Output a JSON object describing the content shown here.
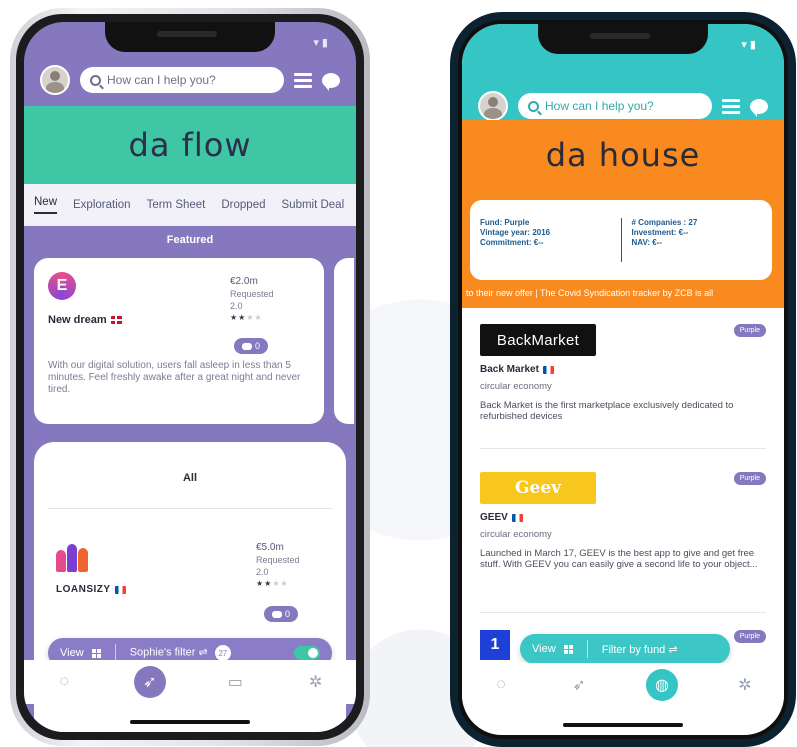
{
  "left_app": {
    "search_placeholder": "How can I help you?",
    "brand": "da flow",
    "tabs": [
      {
        "label": "New",
        "active": true
      },
      {
        "label": "Exploration",
        "active": false
      },
      {
        "label": "Term Sheet",
        "active": false
      },
      {
        "label": "Dropped",
        "active": false
      },
      {
        "label": "Submit Deal",
        "active": false
      }
    ],
    "featured_label": "Featured",
    "featured_card": {
      "logo_letter": "E",
      "name": "New dream",
      "amount": "€2.0m",
      "amount_label": "Requested",
      "version": "2.0",
      "stars_filled": 2,
      "stars_total": 4,
      "message_count": "0",
      "description": "With our digital solution, users fall asleep in less than 5 minutes. Feel freshly awake after a great night and never tired."
    },
    "all_label": "All",
    "list_card": {
      "name": "LOANSIZY",
      "amount": "€5.0m",
      "amount_label": "Requested",
      "version": "2.0",
      "stars_filled": 2,
      "stars_total": 4,
      "message_count": "0"
    },
    "filter_bar": {
      "view_label": "View",
      "filter_label": "Sophie's filter",
      "filter_count": "27",
      "toggle_on": true
    },
    "colors": {
      "accent": "#8678bf",
      "brand_band": "#3fc6a4"
    }
  },
  "right_app": {
    "search_placeholder": "How can I help you?",
    "brand": "da house",
    "fund_card": {
      "fund": "Fund: Purple",
      "vintage": "Vintage year: 2016",
      "commitment": "Commitment: €--",
      "companies": "# Companies : 27",
      "investment": "Investment: €--",
      "nav": "NAV: €--"
    },
    "ticker": "to their new offer  |  The Covid Syndication tracker by ZCB is all",
    "deals": [
      {
        "logo_text": "BackMarket",
        "name": "Back Market",
        "tag": "Purple",
        "sector": "circular economy",
        "description": "Back Market is the first marketplace exclusively dedicated to refurbished devices"
      },
      {
        "logo_text": "Geev",
        "name": "GEEV",
        "tag": "Purple",
        "sector": "circular economy",
        "description": "Launched in March 17, GEEV is the best app to give and get free stuff. With GEEV you can easily give a second life to your object..."
      },
      {
        "logo_text": "1",
        "name": "",
        "tag": "Purple",
        "sector": "",
        "description": ""
      }
    ],
    "filter_bar": {
      "view_label": "View",
      "filter_label": "Filter by fund"
    },
    "colors": {
      "accent": "#35c5c5",
      "brand_band": "#f98a1f"
    }
  }
}
